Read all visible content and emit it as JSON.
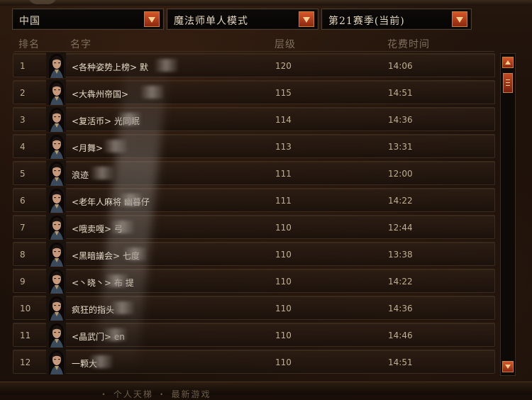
{
  "filters": {
    "region": "中国",
    "mode": "魔法师单人模式",
    "season": "第21赛季(当前)"
  },
  "columns": {
    "rank": "排名",
    "name": "名字",
    "level": "层级",
    "time": "花费时间"
  },
  "rows": [
    {
      "rank": "1",
      "name": "<各种姿势上榜> 默",
      "level": "120",
      "time": "14:06"
    },
    {
      "rank": "2",
      "name": "<大犇州帝国> ",
      "level": "115",
      "time": "14:51"
    },
    {
      "rank": "3",
      "name": "<复活币>    光同眠",
      "level": "114",
      "time": "14:36"
    },
    {
      "rank": "4",
      "name": "<月舞>",
      "level": "113",
      "time": "13:31"
    },
    {
      "rank": "5",
      "name": "浪迹",
      "level": "111",
      "time": "12:00"
    },
    {
      "rank": "6",
      "name": "<老年人麻将    幽暮仔",
      "level": "111",
      "time": "14:22"
    },
    {
      "rank": "7",
      "name": "<哦卖嘎> 弓",
      "level": "110",
      "time": "12:44"
    },
    {
      "rank": "8",
      "name": "<黑暗議会>    七度",
      "level": "110",
      "time": "13:38"
    },
    {
      "rank": "9",
      "name": "<丶晓丶> 布    提",
      "level": "110",
      "time": "14:22"
    },
    {
      "rank": "10",
      "name": "疯狂的指头",
      "level": "110",
      "time": "14:36"
    },
    {
      "rank": "11",
      "name": "<晶武门>     en",
      "level": "110",
      "time": "14:46"
    },
    {
      "rank": "12",
      "name": "一颗大",
      "level": "110",
      "time": "14:51"
    }
  ],
  "footer_text": "・ 个人天梯 ・ 最新游戏",
  "icons": {
    "dropdown": "chevron-down-icon",
    "portrait": "wizard-portrait-icon",
    "scroll_up": "scroll-up-icon",
    "scroll_down": "scroll-down-icon"
  },
  "colors": {
    "accent": "#c2461f",
    "text": "#e6dcc8",
    "muted": "#7d6f5c"
  }
}
